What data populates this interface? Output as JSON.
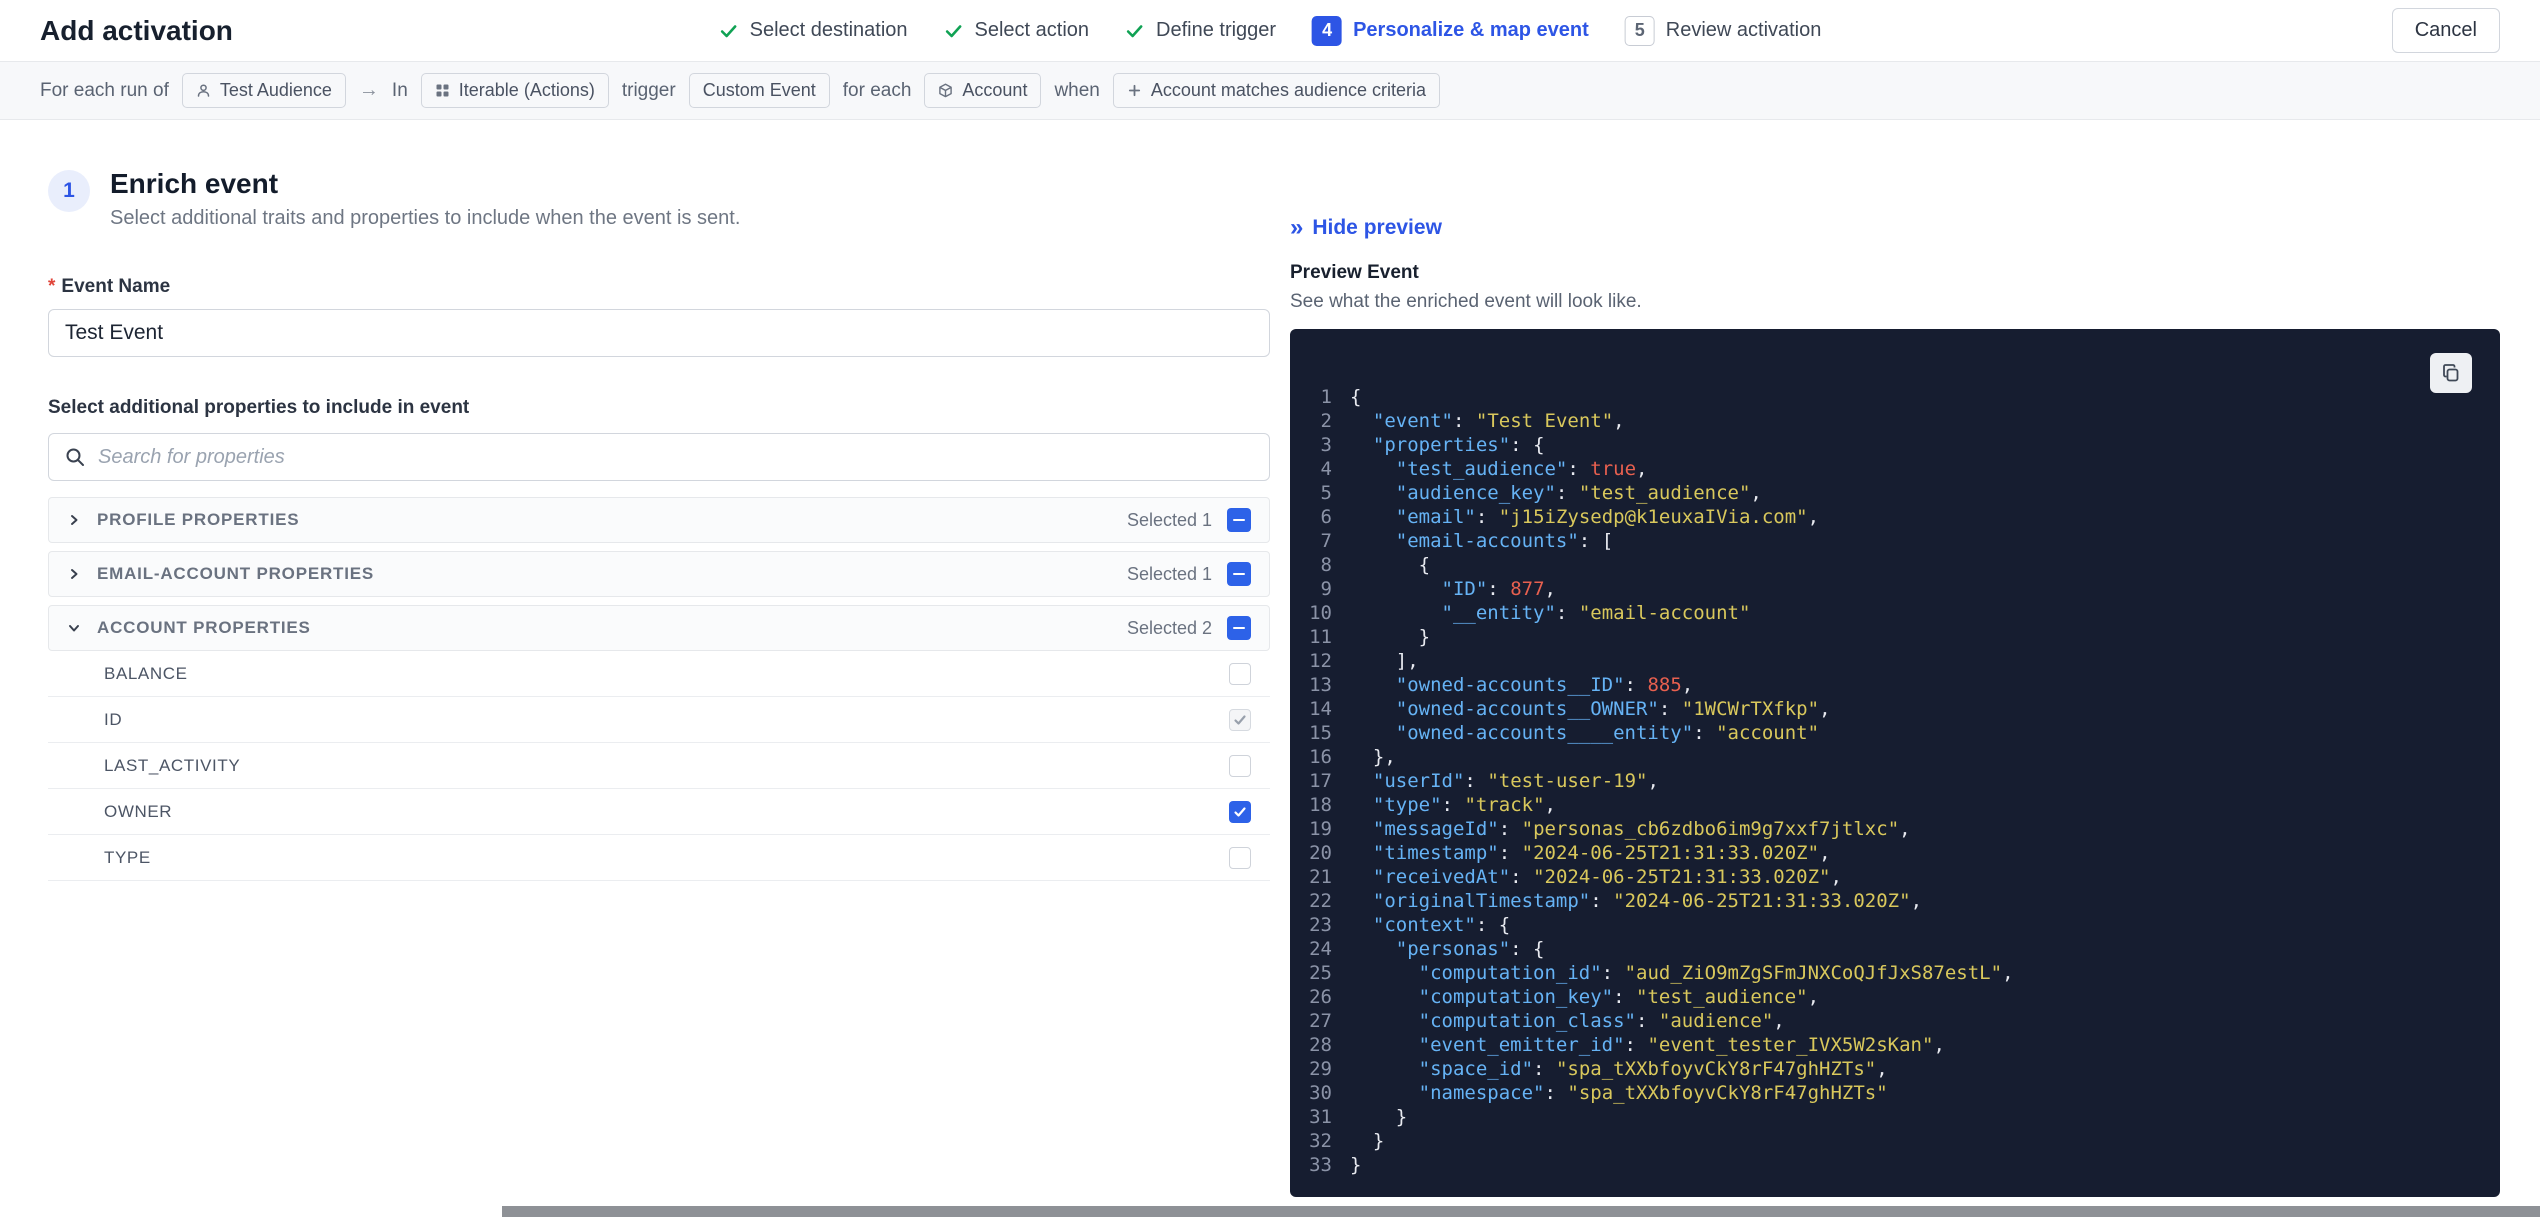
{
  "colors": {
    "accent_blue": "#2d55e5",
    "success_green": "#10a254",
    "checkbox_blue": "#2d62e8",
    "code_bg": "#161d30",
    "code_key": "#66b3f5",
    "code_string": "#d9c85c",
    "code_number": "#e8604f"
  },
  "header": {
    "title": "Add activation",
    "cancel_label": "Cancel",
    "steps": [
      {
        "label": "Select destination",
        "state": "done"
      },
      {
        "label": "Select action",
        "state": "done"
      },
      {
        "label": "Define trigger",
        "state": "done"
      },
      {
        "label": "Personalize & map event",
        "state": "active",
        "num": "4"
      },
      {
        "label": "Review activation",
        "state": "todo",
        "num": "5"
      }
    ]
  },
  "trigger_bar": {
    "items": [
      {
        "kind": "text",
        "text": "For each run of"
      },
      {
        "kind": "chip",
        "icon": "audience-icon",
        "label": "Test Audience"
      },
      {
        "kind": "arrow",
        "text": "→"
      },
      {
        "kind": "text",
        "text": "In"
      },
      {
        "kind": "chip",
        "icon": "destination-icon",
        "label": "Iterable (Actions)"
      },
      {
        "kind": "text",
        "text": "trigger"
      },
      {
        "kind": "chip",
        "label": "Custom Event"
      },
      {
        "kind": "text",
        "text": "for each"
      },
      {
        "kind": "chip",
        "icon": "entity-icon",
        "label": "Account"
      },
      {
        "kind": "text",
        "text": "when"
      },
      {
        "kind": "chip",
        "icon": "plus-icon",
        "label": "Account matches audience criteria"
      }
    ]
  },
  "enrich": {
    "step_number": "1",
    "title": "Enrich event",
    "subtitle": "Select additional traits and properties to include when the event is sent.",
    "required_marker": "*",
    "event_name_label": "Event Name",
    "event_name_value": "Test Event",
    "properties_label": "Select additional properties to include in event",
    "search_placeholder": "Search for properties",
    "groups": [
      {
        "label": "PROFILE PROPERTIES",
        "selected": "Selected 1",
        "expanded": false
      },
      {
        "label": "EMAIL-ACCOUNT PROPERTIES",
        "selected": "Selected 1",
        "expanded": false
      },
      {
        "label": "ACCOUNT PROPERTIES",
        "selected": "Selected 2",
        "expanded": true,
        "items": [
          {
            "label": "BALANCE",
            "checked": false
          },
          {
            "label": "ID",
            "checked": true,
            "disabled": true
          },
          {
            "label": "LAST_ACTIVITY",
            "checked": false
          },
          {
            "label": "OWNER",
            "checked": true
          },
          {
            "label": "TYPE",
            "checked": false
          }
        ]
      }
    ]
  },
  "preview": {
    "hide_label": "Hide preview",
    "title": "Preview Event",
    "subtitle": "See what the enriched event will look like.",
    "code_lines": [
      "{",
      "  \"event\": \"Test Event\",",
      "  \"properties\": {",
      "    \"test_audience\": true,",
      "    \"audience_key\": \"test_audience\",",
      "    \"email\": \"j15iZysedp@k1euxaIVia.com\",",
      "    \"email-accounts\": [",
      "      {",
      "        \"ID\": 877,",
      "        \"__entity\": \"email-account\"",
      "      }",
      "    ],",
      "    \"owned-accounts__ID\": 885,",
      "    \"owned-accounts__OWNER\": \"1WCWrTXfkp\",",
      "    \"owned-accounts____entity\": \"account\"",
      "  },",
      "  \"userId\": \"test-user-19\",",
      "  \"type\": \"track\",",
      "  \"messageId\": \"personas_cb6zdbo6im9g7xxf7jtlxc\",",
      "  \"timestamp\": \"2024-06-25T21:31:33.020Z\",",
      "  \"receivedAt\": \"2024-06-25T21:31:33.020Z\",",
      "  \"originalTimestamp\": \"2024-06-25T21:31:33.020Z\",",
      "  \"context\": {",
      "    \"personas\": {",
      "      \"computation_id\": \"aud_ZiO9mZgSFmJNXCoQJfJxS87estL\",",
      "      \"computation_key\": \"test_audience\",",
      "      \"computation_class\": \"audience\",",
      "      \"event_emitter_id\": \"event_tester_IVX5W2sKan\",",
      "      \"space_id\": \"spa_tXXbfoyvCkY8rF47ghHZTs\",",
      "      \"namespace\": \"spa_tXXbfoyvCkY8rF47ghHZTs\"",
      "    }",
      "  }",
      "}"
    ]
  }
}
